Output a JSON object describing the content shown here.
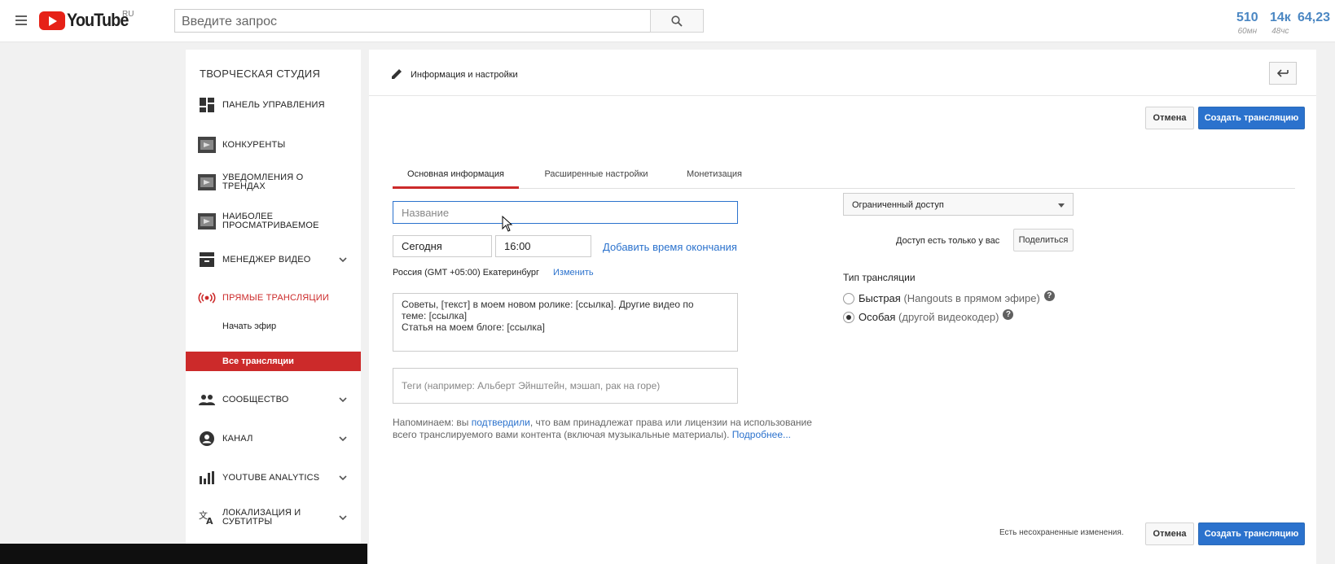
{
  "header": {
    "logo_text": "YouTube",
    "logo_region": "RU",
    "search_placeholder": "Введите запрос",
    "stats": [
      {
        "value": "510",
        "sub": "60мн"
      },
      {
        "value": "14к",
        "sub": "48чс"
      },
      {
        "value": "64,23",
        "sub": ""
      }
    ]
  },
  "sidebar": {
    "title": "ТВОРЧЕСКАЯ СТУДИЯ",
    "items": [
      {
        "label": "ПАНЕЛЬ УПРАВЛЕНИЯ"
      },
      {
        "label": "КОНКУРЕНТЫ"
      },
      {
        "label": "УВЕДОМЛЕНИЯ О ТРЕНДАХ"
      },
      {
        "label": "НАИБОЛЕЕ ПРОСМАТРИВАЕМОЕ"
      },
      {
        "label": "МЕНЕДЖЕР ВИДЕО"
      },
      {
        "label": "ПРЯМЫЕ ТРАНСЛЯЦИИ"
      },
      {
        "label": "СООБЩЕСТВО"
      },
      {
        "label": "КАНАЛ"
      },
      {
        "label": "YOUTUBE ANALYTICS"
      },
      {
        "label": "ЛОКАЛИЗАЦИЯ И СУБТИТРЫ"
      }
    ],
    "sub_start": "Начать эфир",
    "sub_all": "Все трансляции",
    "accent_color": "#cc2a2a"
  },
  "main": {
    "header_title": "Информация и настройки",
    "cancel_label": "Отмена",
    "create_label": "Создать трансляцию",
    "tabs": [
      "Основная информация",
      "Расширенные настройки",
      "Монетизация"
    ],
    "title_placeholder": "Название",
    "date_value": "Сегодня",
    "time_value": "16:00",
    "add_end_time": "Добавить время окончания",
    "timezone": "Россия (GMT +05:00) Екатеринбург",
    "change_label": "Изменить",
    "description_lines": [
      "Советы, [текст] в моем новом ролике: [ссылка]. Другие видео по",
      "теме: [ссылка]",
      "Статья на моем блоге: [ссылка]"
    ],
    "tags_placeholder": "Теги (например: Альберт Эйнштейн, мэшап, рак на горе)",
    "notice_1": "Напоминаем: вы ",
    "notice_link_1": "подтвердили",
    "notice_2": ", что вам принадлежат права или лицензии на использование",
    "notice_3": "всего транслируемого вами контента (включая музыкальные материалы). ",
    "notice_link_2": "Подробнее...",
    "privacy_value": "Ограниченный доступ",
    "access_note": "Доступ есть только у вас",
    "share_label": "Поделиться",
    "broadcast_type_title": "Тип трансляции",
    "option_quick": "Быстрая",
    "option_quick_hint": "(Hangouts в прямом эфире)",
    "option_custom": "Особая",
    "option_custom_hint": "(другой видеокодер)",
    "unsaved_note": "Есть несохраненные изменения.",
    "primary_color": "#2b72cd"
  }
}
